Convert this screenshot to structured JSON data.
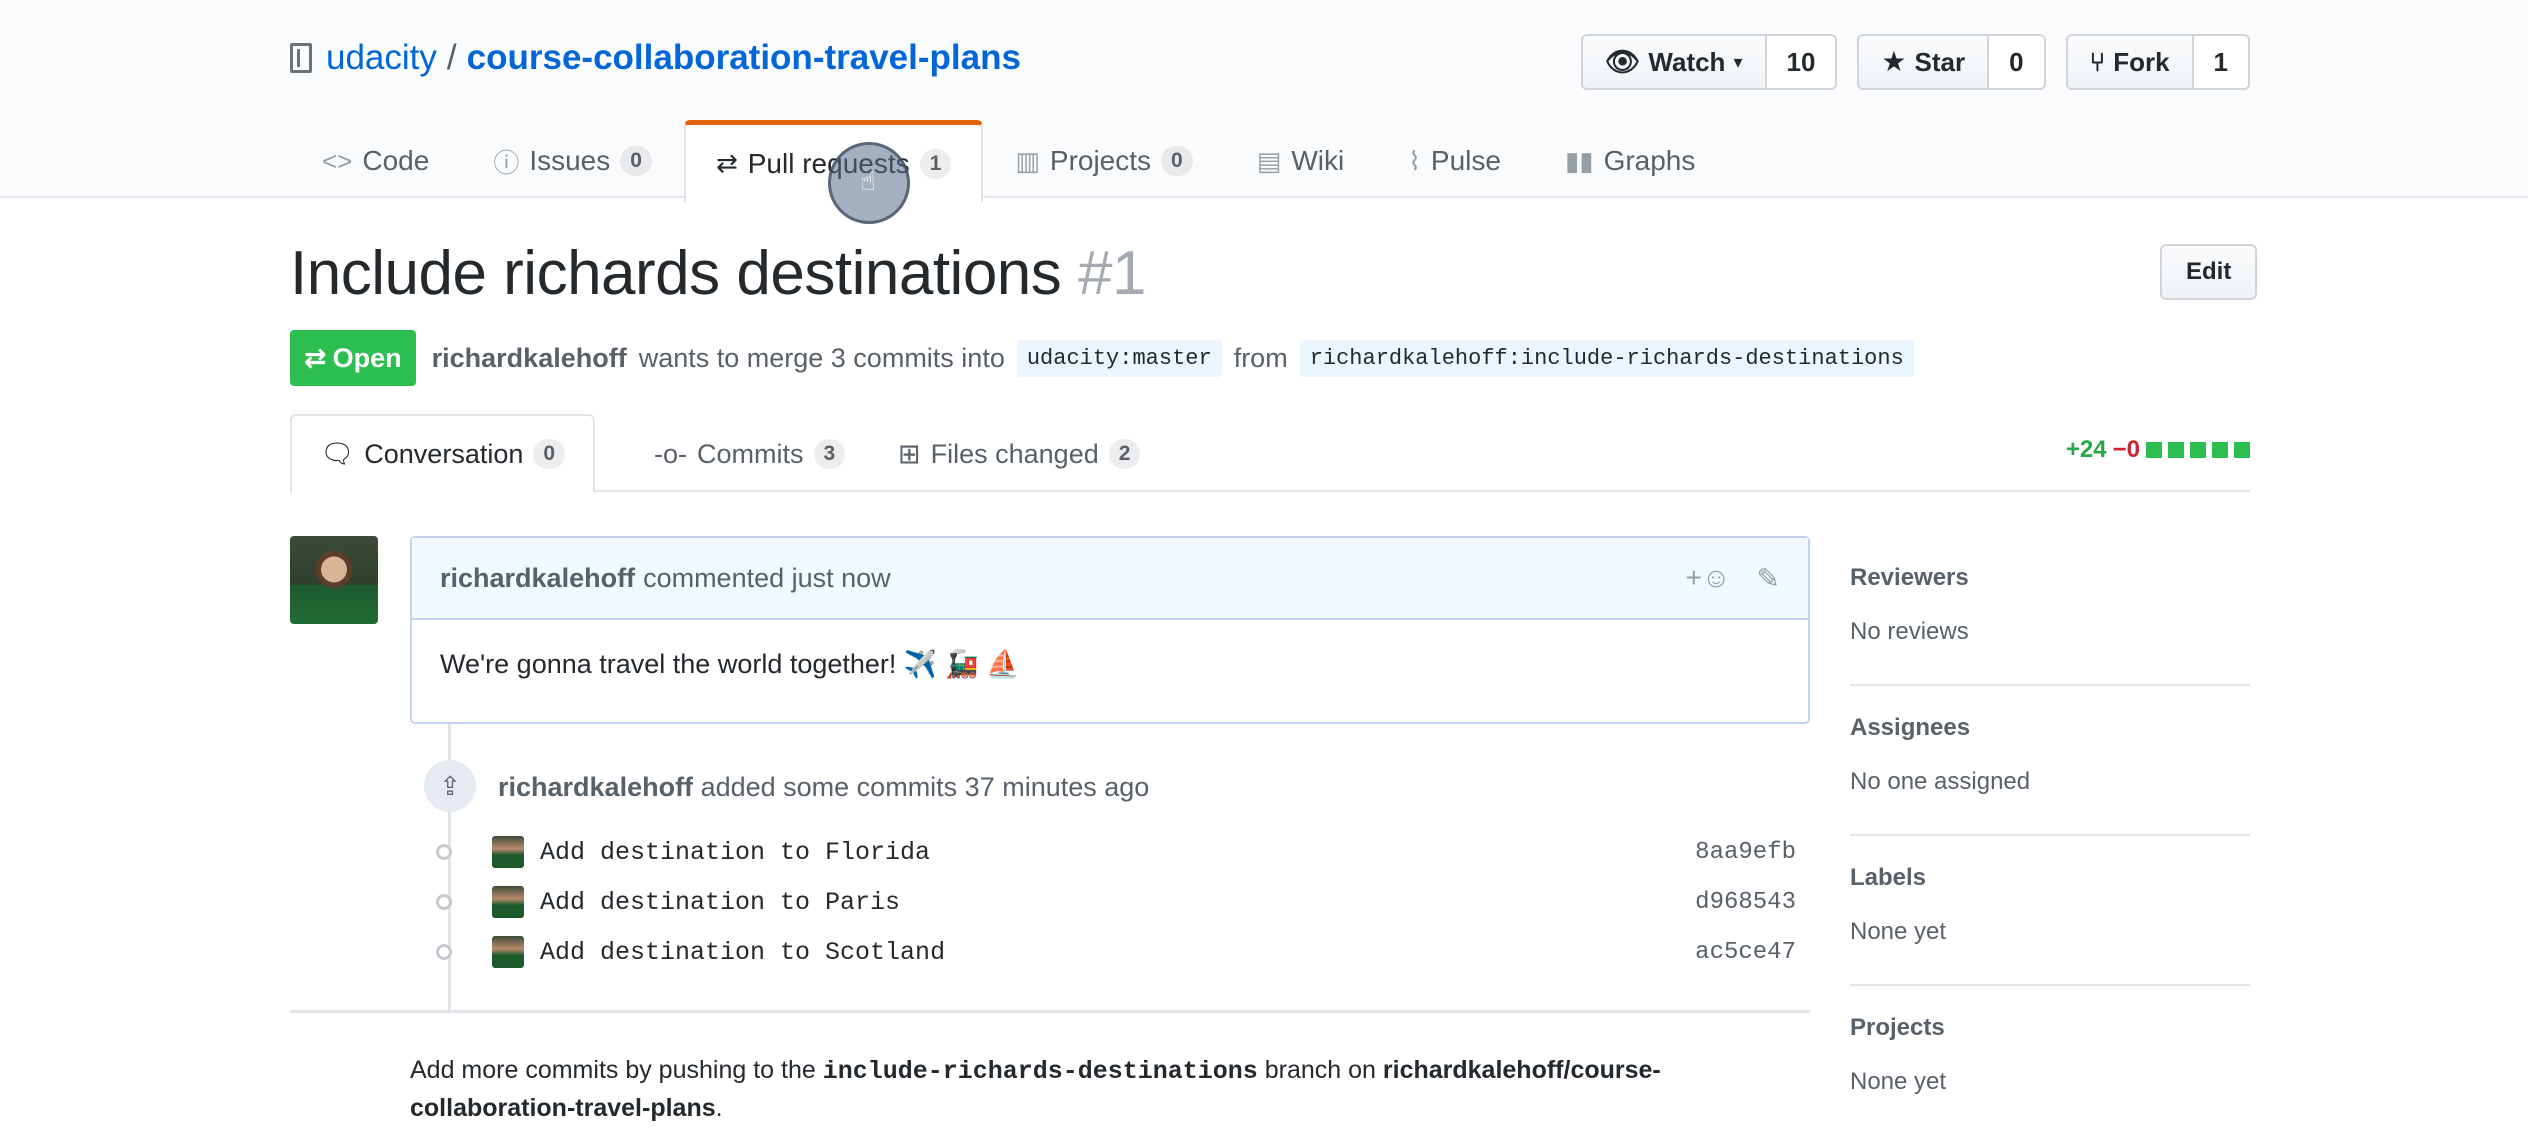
{
  "repo": {
    "owner": "udacity",
    "separator": "/",
    "name": "course-collaboration-travel-plans"
  },
  "actions": {
    "watch": {
      "label": "Watch",
      "count": "10"
    },
    "star": {
      "label": "Star",
      "count": "0"
    },
    "fork": {
      "label": "Fork",
      "count": "1"
    }
  },
  "reponav": [
    {
      "label": "Code",
      "icon": "code-icon",
      "counter": null
    },
    {
      "label": "Issues",
      "icon": "issue-icon",
      "counter": "0"
    },
    {
      "label": "Pull requests",
      "icon": "pull-request-icon",
      "counter": "1"
    },
    {
      "label": "Projects",
      "icon": "project-icon",
      "counter": "0"
    },
    {
      "label": "Wiki",
      "icon": "book-icon",
      "counter": null
    },
    {
      "label": "Pulse",
      "icon": "pulse-icon",
      "counter": null
    },
    {
      "label": "Graphs",
      "icon": "graph-icon",
      "counter": null
    }
  ],
  "pr": {
    "title": "Include richards destinations",
    "number": "#1",
    "edit_label": "Edit",
    "state": "Open",
    "author": "richardkalehoff",
    "meta_text": "wants to merge 3 commits into",
    "base_branch": "udacity:master",
    "from_text": "from",
    "head_branch": "richardkalehoff:include-richards-destinations"
  },
  "tabs": [
    {
      "label": "Conversation",
      "counter": "0"
    },
    {
      "label": "Commits",
      "counter": "3"
    },
    {
      "label": "Files changed",
      "counter": "2"
    }
  ],
  "diffstat": {
    "additions": "+24",
    "deletions": "−0"
  },
  "comment": {
    "author": "richardkalehoff",
    "time": "commented just now",
    "body": "We're gonna travel the world together! ✈️ 🚂 ⛵"
  },
  "commits_event": {
    "author": "richardkalehoff",
    "text": "added some commits 37 minutes ago",
    "commits": [
      {
        "message": "Add destination to Florida",
        "sha": "8aa9efb"
      },
      {
        "message": "Add destination to Paris",
        "sha": "d968543"
      },
      {
        "message": "Add destination to Scotland",
        "sha": "ac5ce47"
      }
    ]
  },
  "help": {
    "prefix": "Add more commits by pushing to the",
    "branch": "include-richards-destinations",
    "middle": "branch on",
    "repo": "richardkalehoff/course-collaboration-travel-plans",
    "suffix": "."
  },
  "sidebar": [
    {
      "title": "Reviewers",
      "value": "No reviews"
    },
    {
      "title": "Assignees",
      "value": "No one assigned"
    },
    {
      "title": "Labels",
      "value": "None yet"
    },
    {
      "title": "Projects",
      "value": "None yet"
    }
  ],
  "colors": {
    "open_green": "#2cbe4e",
    "link_blue": "#0366d6",
    "tab_accent": "#e36209"
  }
}
